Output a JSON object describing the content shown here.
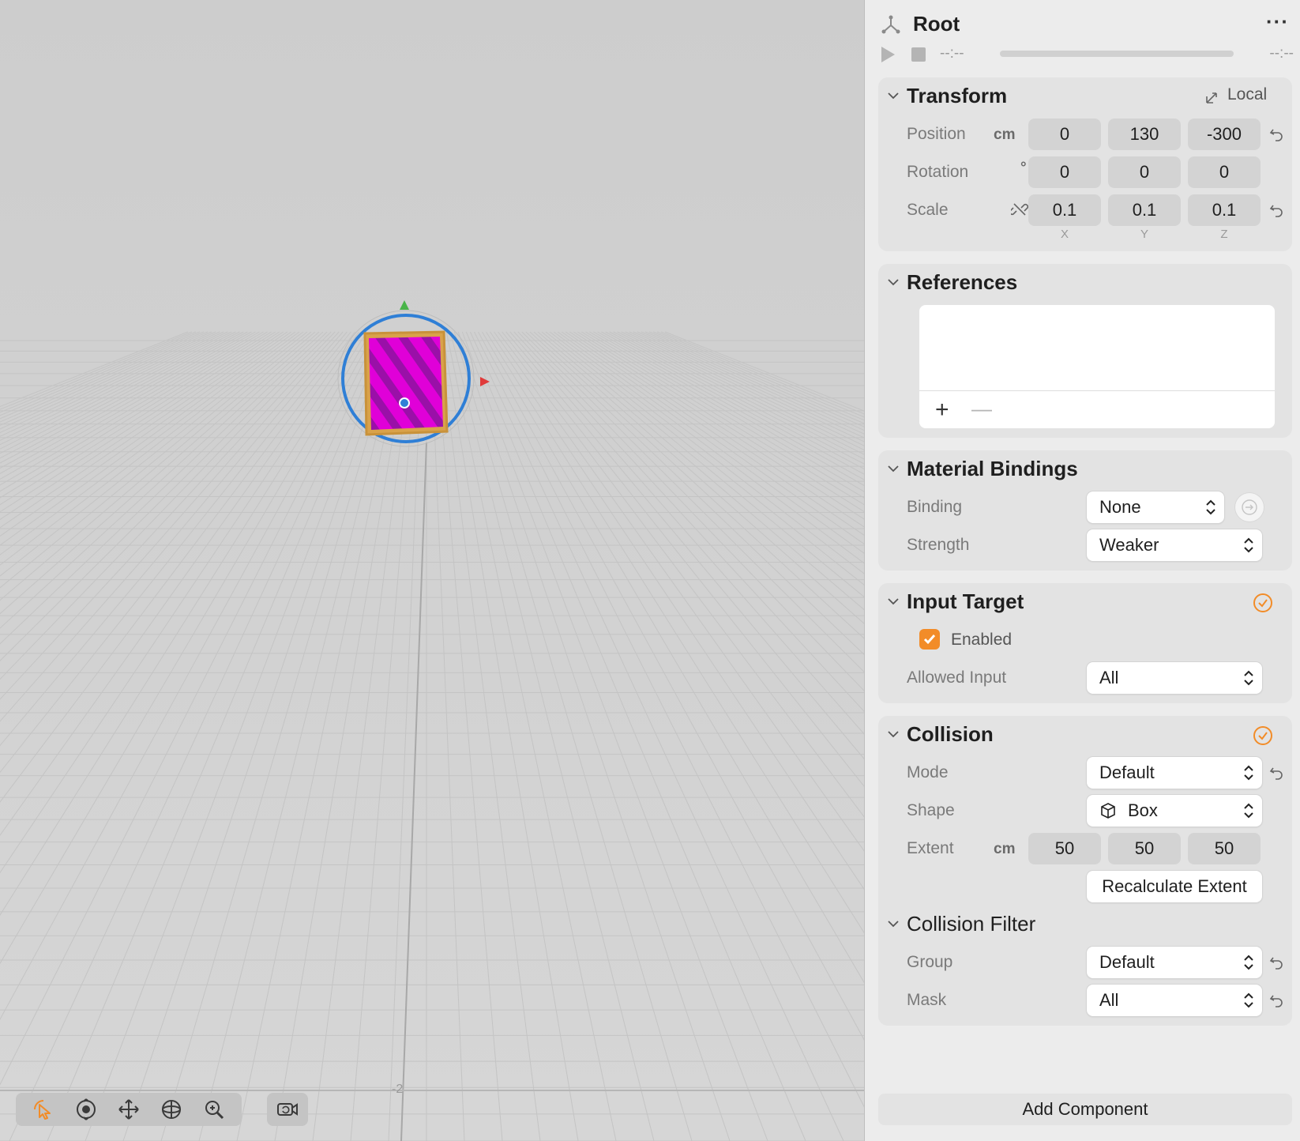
{
  "viewport": {
    "grid_label": "-2",
    "toolbar": {
      "tools": [
        "select-tool-icon",
        "orbit-tool-icon",
        "move-tool-icon",
        "rotate-tool-icon",
        "zoom-tool-icon"
      ],
      "camera": "camera-icon"
    }
  },
  "inspector": {
    "title": "Root",
    "more": "···",
    "time_start": "--:--",
    "time_end": "--:--",
    "transform": {
      "title": "Transform",
      "space": "Local",
      "position_label": "Position",
      "position_unit": "cm",
      "position": [
        "0",
        "130",
        "-300"
      ],
      "rotation_label": "Rotation",
      "rotation_unit": "°",
      "rotation": [
        "0",
        "0",
        "0"
      ],
      "scale_label": "Scale",
      "scale": [
        "0.1",
        "0.1",
        "0.1"
      ],
      "axes": [
        "X",
        "Y",
        "Z"
      ]
    },
    "references": {
      "title": "References",
      "add": "+",
      "remove": "—"
    },
    "material_bindings": {
      "title": "Material Bindings",
      "binding_label": "Binding",
      "binding_value": "None",
      "strength_label": "Strength",
      "strength_value": "Weaker"
    },
    "input_target": {
      "title": "Input Target",
      "enabled_label": "Enabled",
      "enabled": true,
      "allowed_input_label": "Allowed Input",
      "allowed_input_value": "All"
    },
    "collision": {
      "title": "Collision",
      "mode_label": "Mode",
      "mode_value": "Default",
      "shape_label": "Shape",
      "shape_value": "Box",
      "extent_label": "Extent",
      "extent_unit": "cm",
      "extent": [
        "50",
        "50",
        "50"
      ],
      "recalculate_label": "Recalculate Extent",
      "filter_title": "Collision Filter",
      "group_label": "Group",
      "group_value": "Default",
      "mask_label": "Mask",
      "mask_value": "All"
    },
    "add_component_label": "Add Component"
  },
  "colors": {
    "accent": "#f28c28",
    "object_magenta": "#e000d8",
    "gizmo_blue": "#2f7fd6",
    "viewport_bg": "#d3d3d3",
    "inspector_bg": "#ececec"
  }
}
